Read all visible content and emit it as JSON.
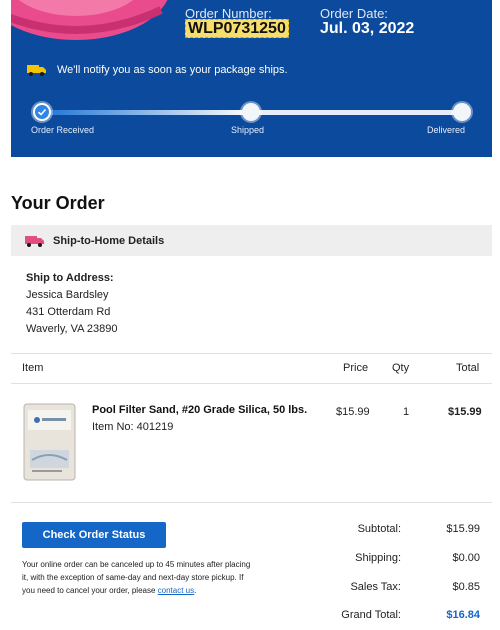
{
  "header": {
    "order_number_label": "Order Number:",
    "order_number": "WLP0731250",
    "order_date_label": "Order Date:",
    "order_date": "Jul. 03, 2022",
    "notify_text": "We'll notify you as soon as your package ships.",
    "steps": [
      {
        "label": "Order Received",
        "status": "done"
      },
      {
        "label": "Shipped",
        "status": "pending"
      },
      {
        "label": "Delivered",
        "status": "pending"
      }
    ],
    "progress_fraction": 0.5
  },
  "order": {
    "title": "Your Order",
    "ship_to_home_label": "Ship-to-Home Details",
    "ship_to_address_label": "Ship to Address:",
    "address_name": "Jessica Bardsley",
    "address_line1": "431 Otterdam Rd",
    "address_line2": "Waverly, VA 23890"
  },
  "table": {
    "headers": [
      "Item",
      "Price",
      "Qty",
      "Total"
    ],
    "rows": [
      {
        "name": "Pool Filter Sand, #20 Grade Silica, 50 lbs.",
        "item_no": "Item No: 401219",
        "price": "$15.99",
        "qty": "1",
        "total": "$15.99"
      }
    ]
  },
  "footer": {
    "check_status_label": "Check Order Status",
    "note_text": "Your online order can be canceled up to 45 minutes after placing it, with the exception of same-day and next-day store pickup. If you need to cancel your order, please",
    "contact_link": "contact us",
    "subtotal_label": "Subtotal:",
    "subtotal": "$15.99",
    "shipping_label": "Shipping:",
    "shipping": "$0.00",
    "tax_label": "Sales Tax:",
    "tax": "$0.85",
    "grand_label": "Grand Total:",
    "grand_total": "$16.84"
  },
  "colors": {
    "header_bg": "#0b4a9c",
    "accent_blue": "#1466c7",
    "highlight_yellow": "#f7dd6b",
    "truck_yellow": "#f5c400",
    "truck_pink": "#e24d82"
  }
}
